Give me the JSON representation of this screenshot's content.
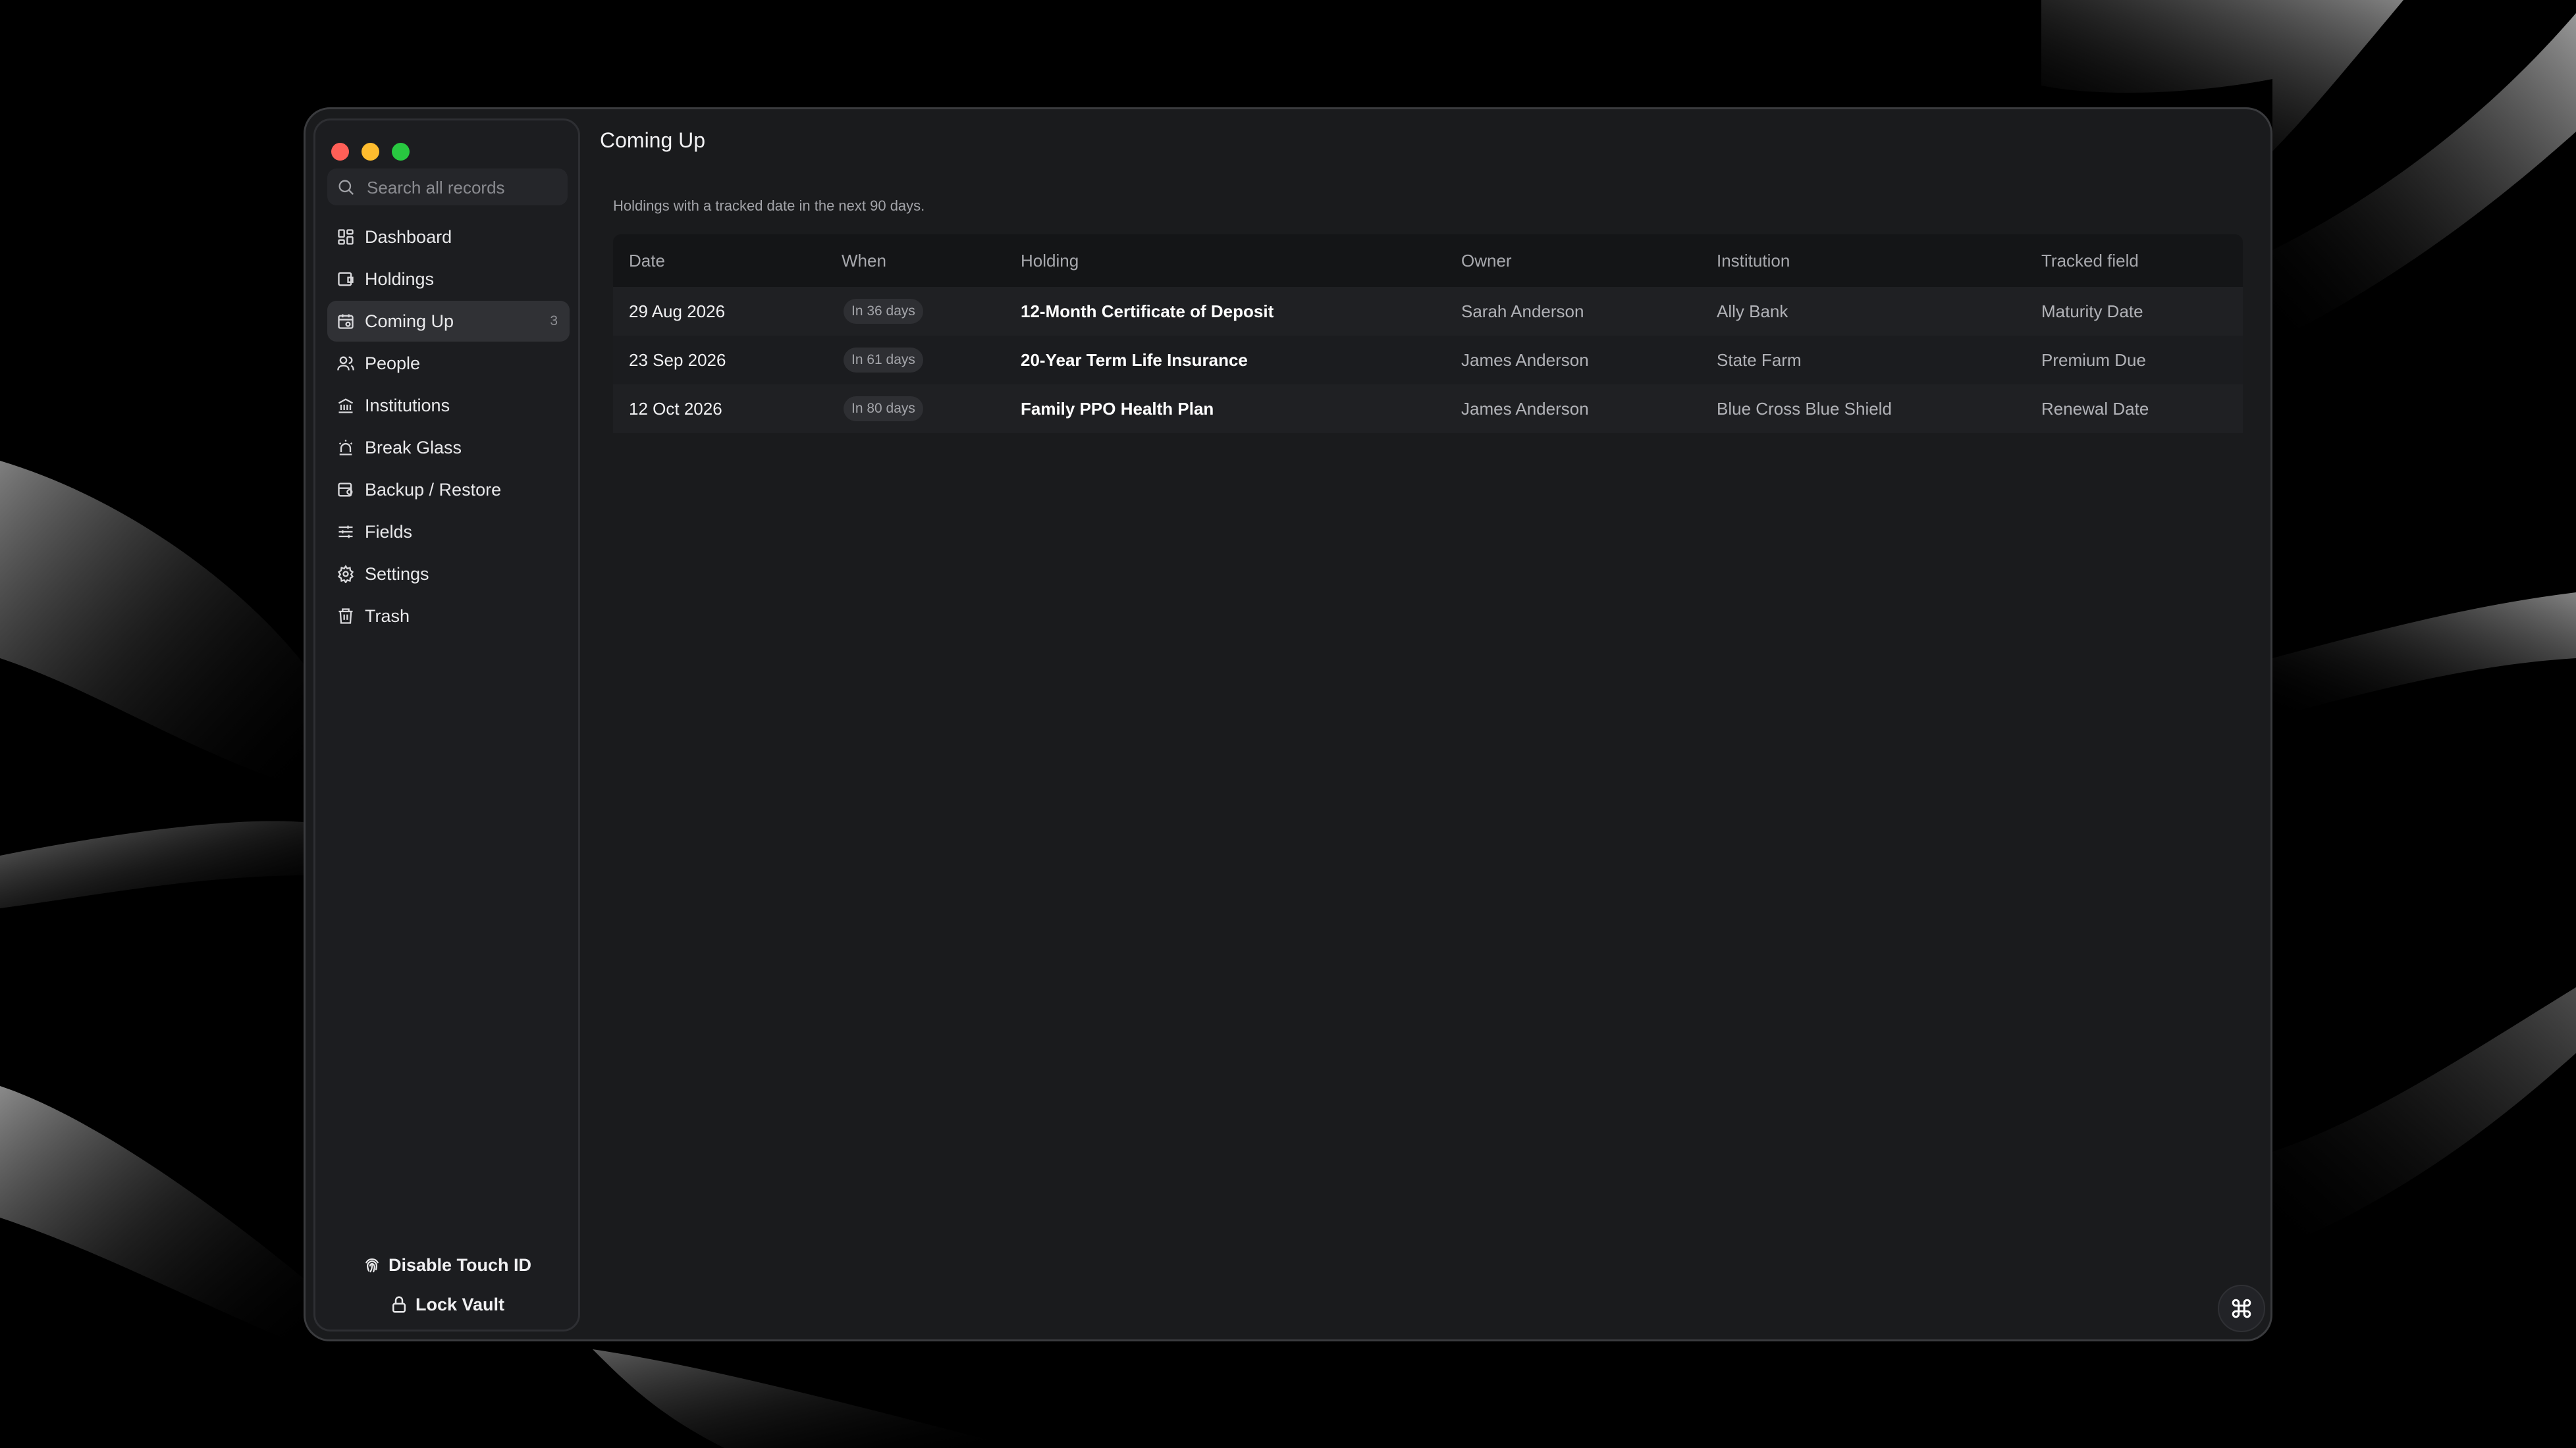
{
  "sidebar": {
    "search_placeholder": "Search all records",
    "items": [
      {
        "label": "Dashboard",
        "icon": "dashboard-icon"
      },
      {
        "label": "Holdings",
        "icon": "holdings-icon"
      },
      {
        "label": "Coming Up",
        "icon": "calendar-icon",
        "count": "3",
        "active": true
      },
      {
        "label": "People",
        "icon": "people-icon"
      },
      {
        "label": "Institutions",
        "icon": "institution-icon"
      },
      {
        "label": "Break Glass",
        "icon": "alarm-icon"
      },
      {
        "label": "Backup / Restore",
        "icon": "backup-icon"
      },
      {
        "label": "Fields",
        "icon": "sliders-icon"
      },
      {
        "label": "Settings",
        "icon": "gear-icon"
      },
      {
        "label": "Trash",
        "icon": "trash-icon"
      }
    ],
    "disable_touch_id": "Disable Touch ID",
    "lock_vault": "Lock Vault"
  },
  "main": {
    "title": "Coming Up",
    "subtitle": "Holdings with a tracked date in the next 90 days.",
    "columns": [
      "Date",
      "When",
      "Holding",
      "Owner",
      "Institution",
      "Tracked field"
    ],
    "rows": [
      {
        "date": "29 Aug 2026",
        "when": "In 36 days",
        "holding": "12-Month Certificate of Deposit",
        "owner": "Sarah Anderson",
        "institution": "Ally Bank",
        "field": "Maturity Date"
      },
      {
        "date": "23 Sep 2026",
        "when": "In 61 days",
        "holding": "20-Year Term Life Insurance",
        "owner": "James Anderson",
        "institution": "State Farm",
        "field": "Premium Due"
      },
      {
        "date": "12 Oct 2026",
        "when": "In 80 days",
        "holding": "Family PPO Health Plan",
        "owner": "James Anderson",
        "institution": "Blue Cross Blue Shield",
        "field": "Renewal Date"
      }
    ]
  },
  "colors": {
    "window_bg": "#1a1b1d",
    "sidebar_bg": "#1c1d20",
    "active_item_bg": "#303135",
    "traffic_red": "#ff5f57",
    "traffic_yellow": "#febc2e",
    "traffic_green": "#28c840"
  }
}
